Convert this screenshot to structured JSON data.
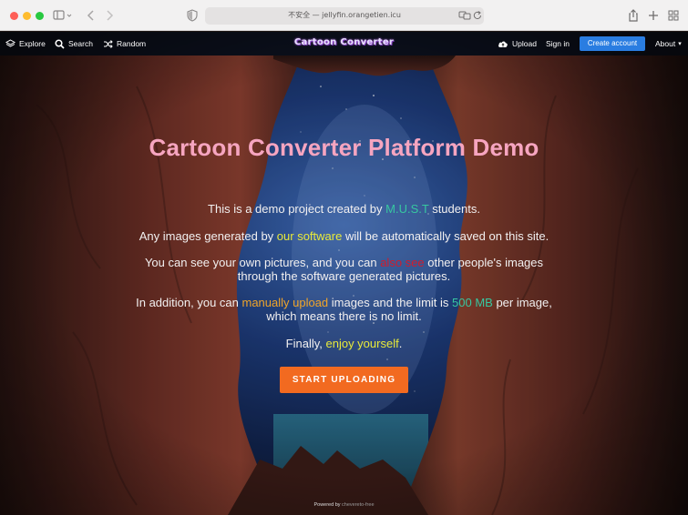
{
  "browser": {
    "address": "不安全 — jellyfin.orangetien.icu",
    "icons": [
      "sidebar-icon",
      "chevron-left-icon",
      "chevron-right-icon",
      "shield-icon",
      "translate-icon",
      "reload-icon",
      "share-icon",
      "plus-icon",
      "tabs-grid-icon"
    ]
  },
  "nav": {
    "explore": "Explore",
    "search": "Search",
    "random": "Random",
    "brand": "Cartoon Converter",
    "upload": "Upload",
    "sign_in": "Sign in",
    "create_account": "Create account",
    "about": "About",
    "about_caret": "▾"
  },
  "hero": {
    "title": "Cartoon Converter Platform Demo",
    "line1": {
      "a": "This is a demo project created by ",
      "b": "M.U.S.T",
      "c": " students."
    },
    "line2": {
      "a": "Any images generated by ",
      "b": "our software",
      "c": " will be automatically saved on this site."
    },
    "line3": {
      "a": "You can see your own pictures, and you can ",
      "b": "also see",
      "c": " other people's images",
      "d": "through the software generated pictures."
    },
    "line4": {
      "a": "In addition, you can ",
      "b": "manually upload",
      "c": " images and the limit is ",
      "d": "500 MB",
      "e": " per image,",
      "f": "which means there is no limit."
    },
    "line5": {
      "a": "Finally, ",
      "b": "enjoy yourself",
      "c": "."
    },
    "cta": "START UPLOADING"
  },
  "footer": {
    "a": "Powered by",
    "b": "chevereto-free"
  },
  "colors": {
    "title": "#f6a5c0",
    "green": "#37c7a0",
    "yellow": "#e8ea3a",
    "red": "#cf1d2e",
    "orange": "#f0a52a",
    "cta": "#f26a20",
    "button": "#2a7de1"
  }
}
